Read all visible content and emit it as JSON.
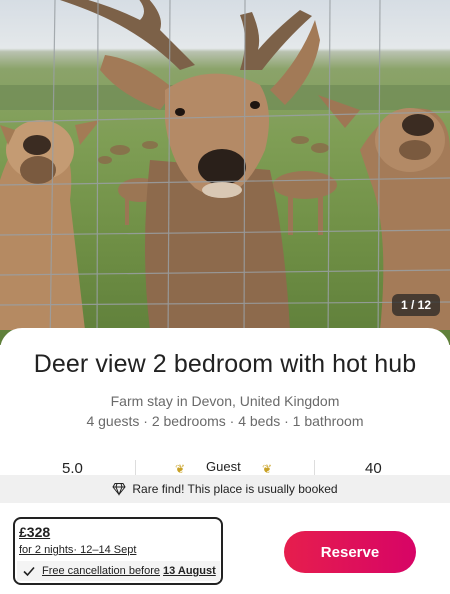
{
  "listing": {
    "photo_counter": "1 / 12",
    "title": "Deer view 2 bedroom with hot hub",
    "subtitle": "Farm stay in Devon, United Kingdom",
    "details": "4 guests · 2 bedrooms · 4 beds · 1 bathroom"
  },
  "stats": {
    "rating": "5.0",
    "badge": "Guest",
    "reviews": "40"
  },
  "banner": {
    "text": "Rare find! This place is usually booked"
  },
  "booking": {
    "price": "£328",
    "nights": "for 2 nights· 12–14 Sept",
    "cancellation": "Free cancellation before",
    "cancellation_date": "13 August",
    "reserve_label": "Reserve"
  },
  "colors": {
    "accent": "#e61e4d",
    "accent_end": "#d70466",
    "text": "#222222",
    "muted": "#6a6a6a"
  },
  "icons": {
    "banner": "diamond-icon",
    "cancellation": "check-icon",
    "badge": "laurel-icon"
  }
}
